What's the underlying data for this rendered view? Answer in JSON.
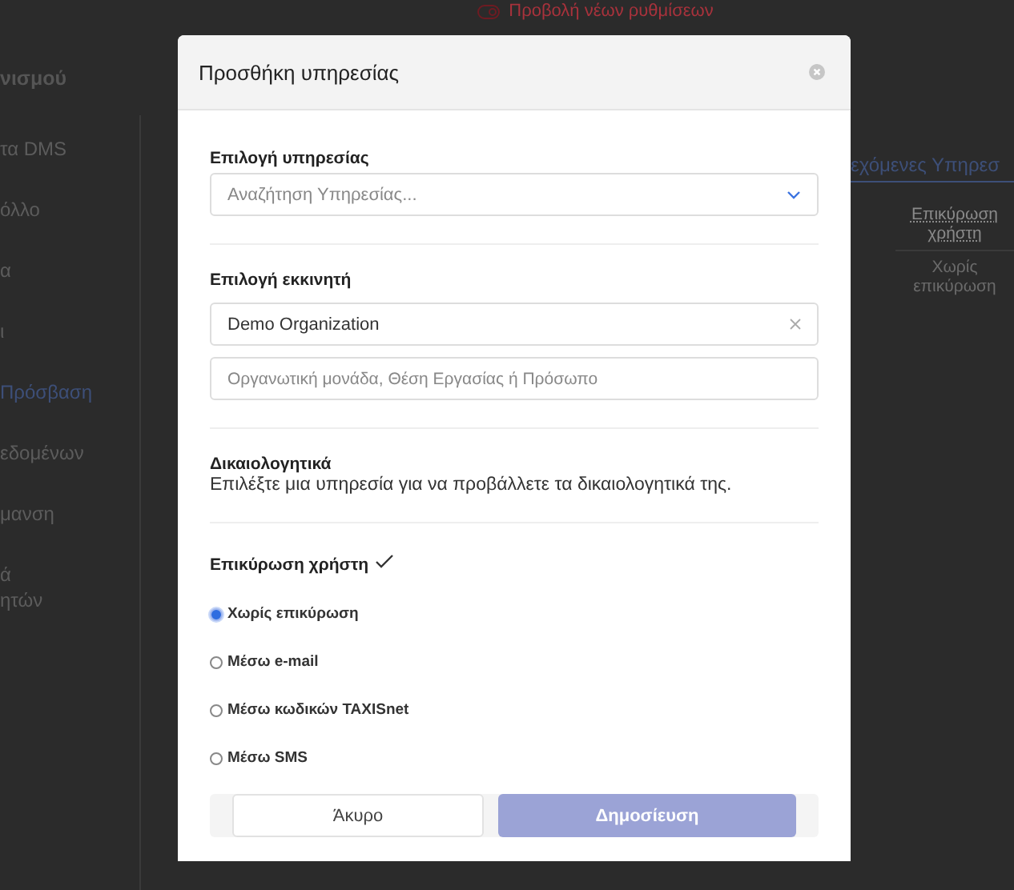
{
  "background": {
    "top_link": {
      "label": "Προβολή νέων ρυθμίσεων"
    },
    "sidebar": {
      "title": "νισμού",
      "items": [
        {
          "label": "τα DMS",
          "selected": false
        },
        {
          "label": "όλλο",
          "selected": false
        },
        {
          "label": "α",
          "selected": false
        },
        {
          "label": "ι",
          "selected": false
        },
        {
          "label": "Πρόσβαση",
          "selected": true
        },
        {
          "label": "εδομένων",
          "selected": false
        },
        {
          "label": "μανση",
          "selected": false
        },
        {
          "label": "ά\nητών",
          "selected": false
        }
      ]
    },
    "tab": {
      "label": "εχόμενες Υπηρεσ",
      "selected": true
    },
    "table": {
      "columns": [
        "Επικύρωση χρήστη"
      ],
      "rows": [
        [
          "Χωρίς επικύρωση"
        ]
      ]
    }
  },
  "dialog": {
    "title": "Προσθήκη υπηρεσίας",
    "service": {
      "label": "Επιλογή υπηρεσίας",
      "placeholder": "Αναζήτηση Υπηρεσίας..."
    },
    "initiator": {
      "label": "Επιλογή εκκινητή",
      "value": "Demo Organization",
      "placeholder": "Οργανωτική μονάδα, Θέση Εργασίας ή Πρόσωπο"
    },
    "documents": {
      "label": "Δικαιολογητικά",
      "text": "Επιλέξτε μια υπηρεσία για να προβάλλετε τα δικαιολογητικά της."
    },
    "verification": {
      "label": "Επικύρωση χρήστη",
      "confirmed": true,
      "options": [
        {
          "label": "Χωρίς επικύρωση",
          "selected": true
        },
        {
          "label": "Μέσω e-mail",
          "selected": false
        },
        {
          "label": "Μέσω κωδικών TAXISnet",
          "selected": false
        },
        {
          "label": "Μέσω SMS",
          "selected": false
        }
      ]
    },
    "buttons": [
      {
        "kind": "cancel",
        "label": "Άκυρο"
      },
      {
        "kind": "primary",
        "label": "Δημοσίευση",
        "disabled": true
      }
    ]
  }
}
